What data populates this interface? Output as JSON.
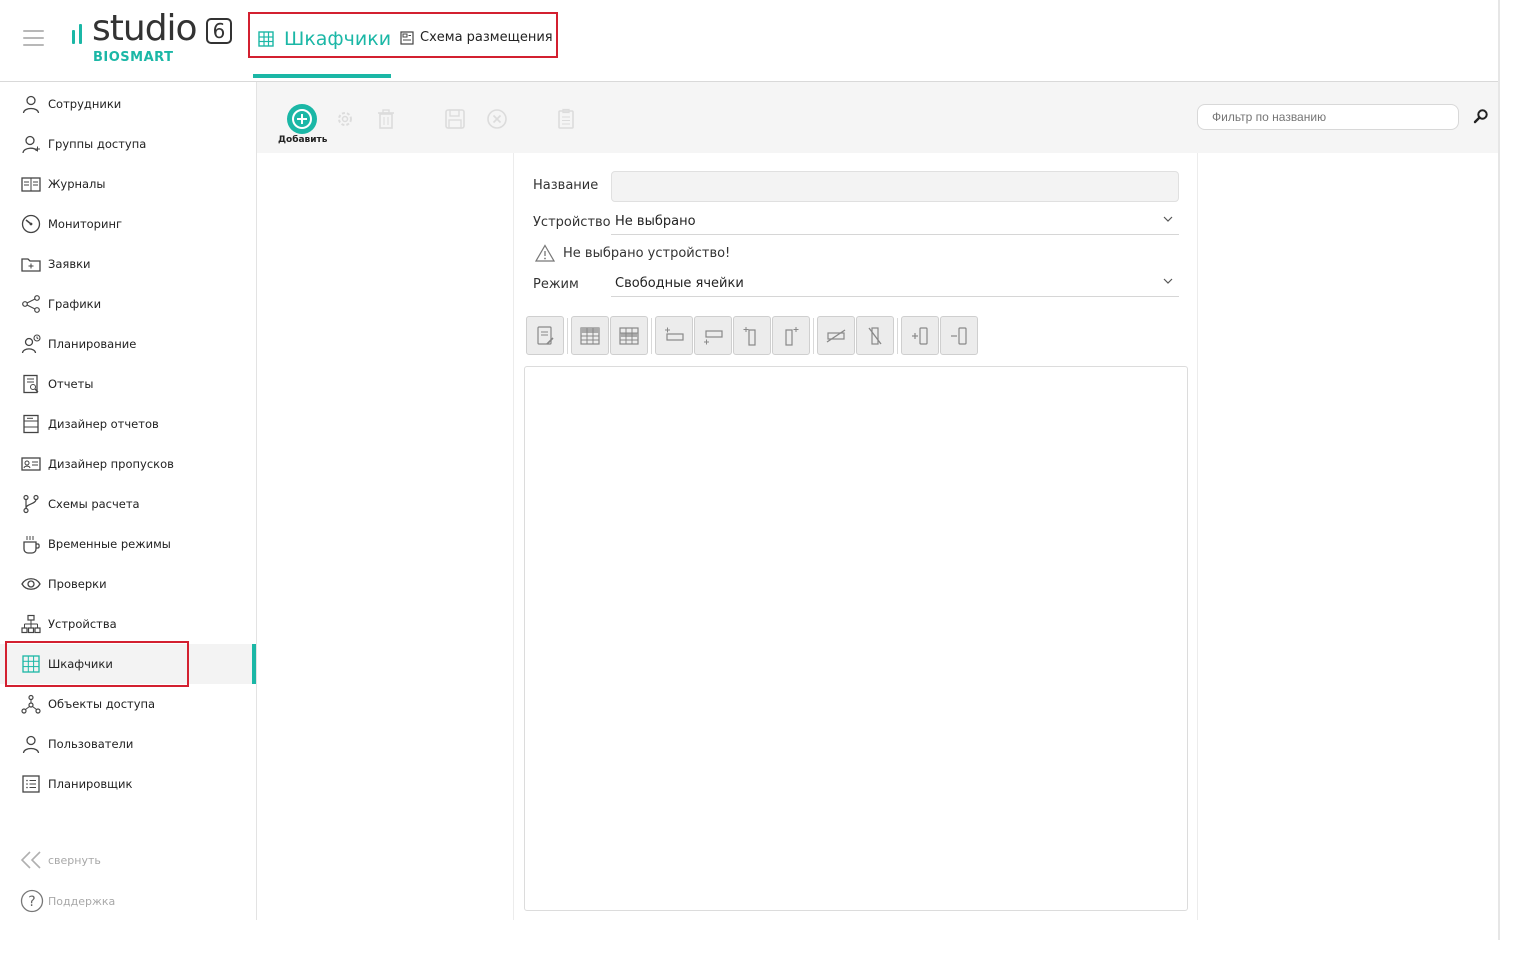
{
  "brand": {
    "name": "studio",
    "version": "6",
    "company": "BIOSMART"
  },
  "tabs": [
    {
      "label": "Шкафчики",
      "icon": "locker-grid-icon"
    },
    {
      "label": "Схема размещения",
      "icon": "layout-scheme-icon"
    }
  ],
  "sidebar": {
    "items": [
      {
        "label": "Сотрудники",
        "icon": "user-icon"
      },
      {
        "label": "Группы доступа",
        "icon": "user-group-icon"
      },
      {
        "label": "Журналы",
        "icon": "book-icon"
      },
      {
        "label": "Мониторинг",
        "icon": "gauge-icon"
      },
      {
        "label": "Заявки",
        "icon": "folder-plus-icon"
      },
      {
        "label": "Графики",
        "icon": "share-icon"
      },
      {
        "label": "Планирование",
        "icon": "user-clock-icon"
      },
      {
        "label": "Отчеты",
        "icon": "report-search-icon"
      },
      {
        "label": "Дизайнер отчетов",
        "icon": "report-design-icon"
      },
      {
        "label": "Дизайнер пропусков",
        "icon": "id-card-icon"
      },
      {
        "label": "Схемы расчета",
        "icon": "branch-icon"
      },
      {
        "label": "Временные режимы",
        "icon": "cup-icon"
      },
      {
        "label": "Проверки",
        "icon": "eye-icon"
      },
      {
        "label": "Устройства",
        "icon": "network-icon"
      },
      {
        "label": "Шкафчики",
        "icon": "locker-grid-icon"
      },
      {
        "label": "Объекты доступа",
        "icon": "nodes-icon"
      },
      {
        "label": "Пользователи",
        "icon": "user-icon"
      },
      {
        "label": "Планировщик",
        "icon": "list-icon"
      }
    ],
    "active_index": 14,
    "collapse_label": "свернуть",
    "support_label": "Поддержка"
  },
  "toolbar": {
    "add_label": "Добавить",
    "filter_placeholder": "Фильтр по названию"
  },
  "form": {
    "name_label": "Название",
    "name_value": "",
    "device_label": "Устройство",
    "device_value": "Не выбрано",
    "warning_text": "Не выбрано устройство!",
    "mode_label": "Режим",
    "mode_value": "Свободные ячейки"
  },
  "colors": {
    "accent": "#1bb7a6",
    "highlight_box": "#d32030"
  }
}
